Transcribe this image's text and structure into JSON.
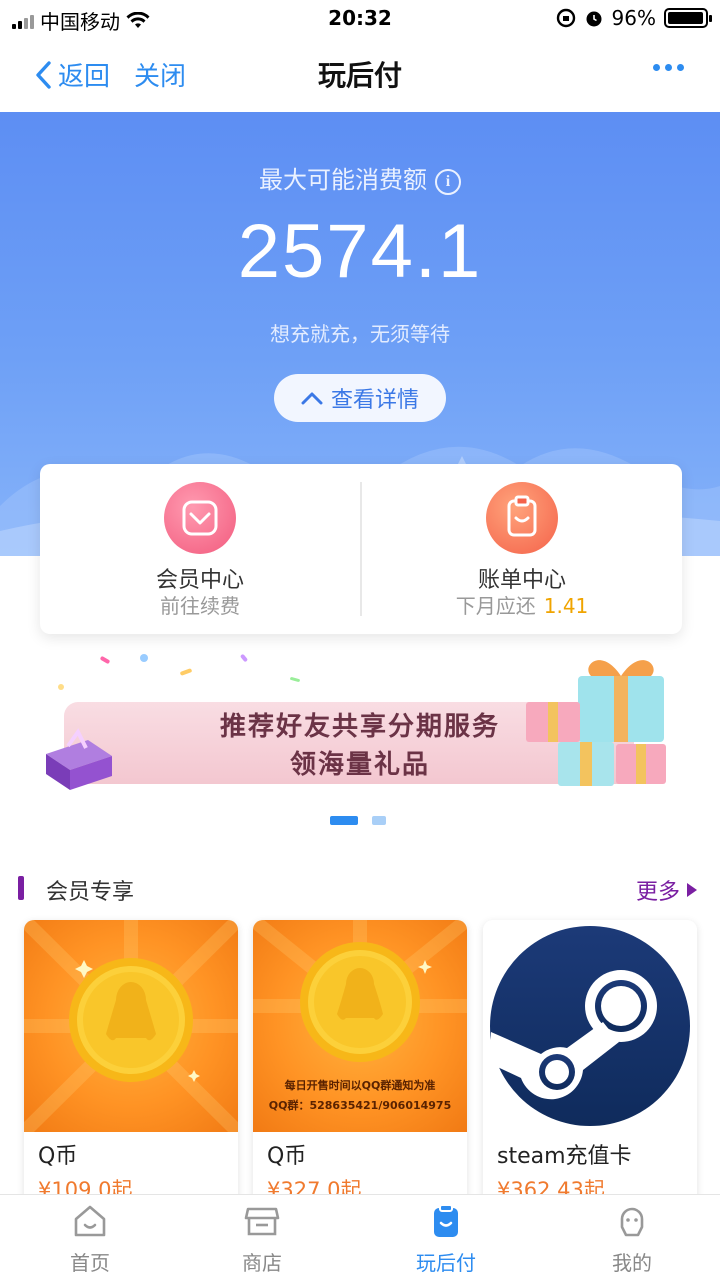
{
  "status_bar": {
    "carrier": "中国移动",
    "time": "20:32",
    "battery": "96%",
    "battery_level": 0.96
  },
  "nav": {
    "back_label": "返回",
    "close_label": "关闭",
    "title": "玩后付"
  },
  "hero": {
    "caption": "最大可能消费额",
    "amount": "2574.1",
    "subtitle": "想充就充，无须等待",
    "details_button": "查看详情"
  },
  "cards": {
    "member": {
      "title": "会员中心",
      "sub": "前往续费"
    },
    "bill": {
      "title": "账单中心",
      "sub": "下月应还",
      "amount": "1.41"
    }
  },
  "banner": {
    "line1": "推荐好友共享分期服务",
    "line2": "领海量礼品",
    "pages": 2,
    "active_page": 1
  },
  "section": {
    "title": "会员专享",
    "more": "更多"
  },
  "products": [
    {
      "name": "Q币",
      "price": "¥109.0起"
    },
    {
      "name": "Q币",
      "price": "¥327.0起",
      "notice_line1": "每日开售时间以QQ群通知为准",
      "notice_line2": "QQ群：528635421/906014975"
    },
    {
      "name": "steam充值卡",
      "price": "¥362.43起"
    }
  ],
  "tabbar": {
    "tabs": [
      {
        "label": "首页",
        "icon": "home-icon"
      },
      {
        "label": "商店",
        "icon": "store-icon"
      },
      {
        "label": "玩后付",
        "icon": "clipboard-icon",
        "active": true
      },
      {
        "label": "我的",
        "icon": "profile-icon"
      }
    ]
  },
  "colors": {
    "accent": "#2d8cf0",
    "hero_top": "#5d8ef3",
    "price": "#f07a2e",
    "bill_amount": "#f0a400",
    "section_accent": "#7a1fa2"
  }
}
